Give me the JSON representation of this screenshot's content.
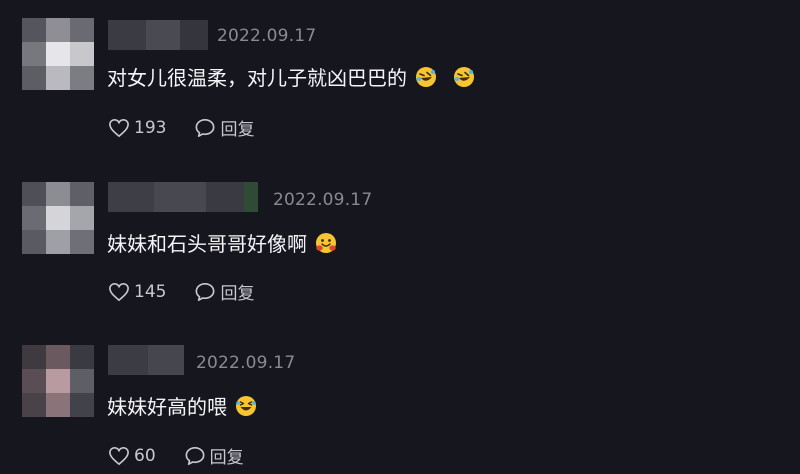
{
  "comments": [
    {
      "date": "2022.09.17",
      "text": "对女儿很温柔，对儿子就凶巴巴的",
      "emojis": [
        "rolling-on-floor-laughing-icon",
        "rolling-on-floor-laughing-icon"
      ],
      "likes": "193",
      "reply_label": "回复"
    },
    {
      "date": "2022.09.17",
      "text": "妹妹和石头哥哥好像啊",
      "emojis": [
        "hugging-face-icon"
      ],
      "likes": "145",
      "reply_label": "回复"
    },
    {
      "date": "2022.09.17",
      "text": "妹妹好高的喂",
      "emojis": [
        "grinning-squinting-face-icon"
      ],
      "likes": "60",
      "reply_label": "回复"
    }
  ],
  "colors": {
    "background": "#16161f",
    "date": "#8a8a94",
    "text": "#f5f5f7",
    "action": "#c8c8d0",
    "emoji_yellow": "#f7c531"
  }
}
